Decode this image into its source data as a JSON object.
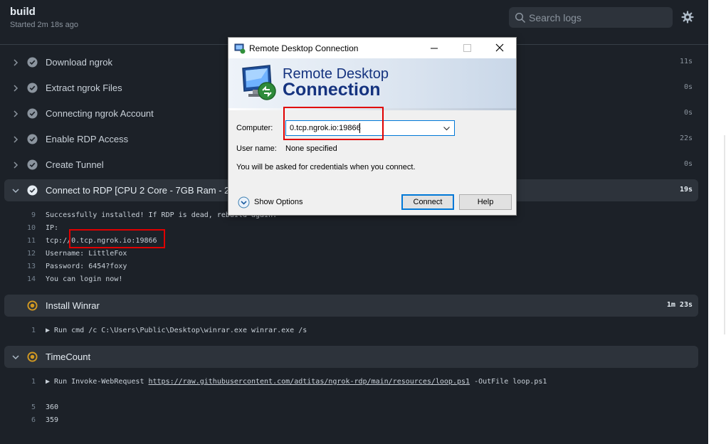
{
  "job": {
    "title": "build",
    "started": "Started 2m 18s ago",
    "search_placeholder": "Search logs",
    "settings_icon": "gear-icon"
  },
  "steps": [
    {
      "name": "Download ngrok",
      "duration": "11s",
      "status": "success",
      "expanded": false
    },
    {
      "name": "Extract ngrok Files",
      "duration": "0s",
      "status": "success",
      "expanded": false
    },
    {
      "name": "Connecting ngrok Account",
      "duration": "0s",
      "status": "success",
      "expanded": false
    },
    {
      "name": "Enable RDP Access",
      "duration": "22s",
      "status": "success",
      "expanded": false
    },
    {
      "name": "Create Tunnel",
      "duration": "0s",
      "status": "success",
      "expanded": false
    },
    {
      "name": "Connect to RDP [CPU 2 Core - 7GB Ram - 256",
      "duration": "19s",
      "status": "success",
      "expanded": true
    },
    {
      "name": "Install Winrar",
      "duration": "1m 23s",
      "status": "in-progress",
      "expanded": true
    },
    {
      "name": "TimeCount",
      "duration": "",
      "status": "in-progress",
      "expanded": true
    }
  ],
  "rdp_log": [
    {
      "n": "9",
      "text": "Successfully installed! If RDP is dead, rebuild again."
    },
    {
      "n": "10",
      "text": "IP:"
    },
    {
      "n": "11",
      "text": "tcp://0.tcp.ngrok.io:19866"
    },
    {
      "n": "12",
      "text": "Username: LittleFox"
    },
    {
      "n": "13",
      "text": "Password: 6454?foxy"
    },
    {
      "n": "14",
      "text": "You can login now!"
    }
  ],
  "winrar_log": [
    {
      "n": "1",
      "text": "▶ Run cmd /c C:\\Users\\Public\\Desktop\\winrar.exe winrar.exe /s"
    }
  ],
  "timecount_log": {
    "line1_n": "1",
    "line1_prefix": "▶ Run Invoke-WebRequest ",
    "line1_link": "https://raw.githubusercontent.com/adtitas/ngrok-rdp/main/resources/loop.ps1",
    "line1_suffix": " -OutFile loop.ps1",
    "lines": [
      {
        "n": "5",
        "text": "360"
      },
      {
        "n": "6",
        "text": "359"
      }
    ]
  },
  "dialog": {
    "window_title": "Remote Desktop Connection",
    "banner_line1": "Remote Desktop",
    "banner_line2": "Connection",
    "computer_label": "Computer:",
    "computer_value": "0.tcp.ngrok.io:19866",
    "username_label": "User name:",
    "username_value": "None specified",
    "info_text": "You will be asked for credentials when you connect.",
    "show_options": "Show Options",
    "connect_button": "Connect",
    "help_button": "Help"
  },
  "colors": {
    "background": "#1c2128",
    "expanded_step": "#2d333b",
    "success": "#8b949e",
    "in_progress": "#d29922",
    "highlight_box": "#e00000",
    "dialog_accent": "#0078d7",
    "banner_text": "#15337f"
  }
}
